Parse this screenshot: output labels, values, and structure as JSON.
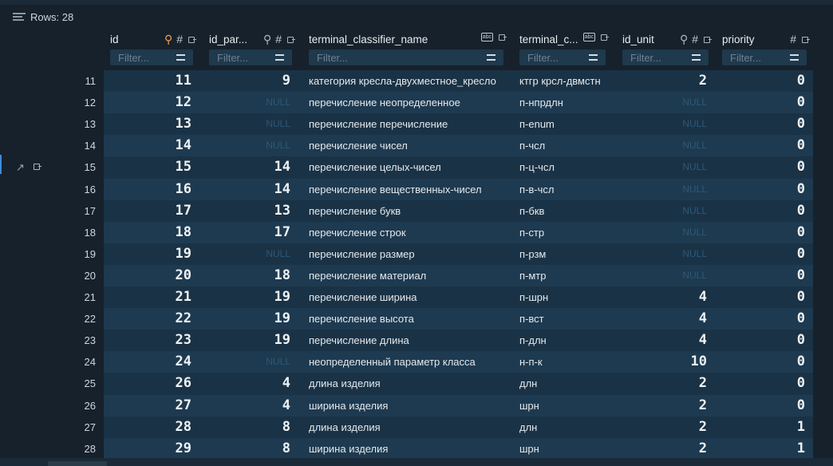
{
  "rows_label": "Rows: 28",
  "columns": [
    {
      "key": "id",
      "label": "id",
      "filter": "Filter...",
      "icons": [
        "key-icon",
        "hash-icon",
        "pin-icon"
      ]
    },
    {
      "key": "id_parent",
      "label": "id_par...",
      "filter": "Filter...",
      "icons": [
        "key-icon",
        "hash-icon",
        "pin-icon"
      ]
    },
    {
      "key": "name",
      "label": "terminal_classifier_name",
      "filter": "Filter...",
      "icons": [
        "abc-icon",
        "pin-icon"
      ]
    },
    {
      "key": "abbr",
      "label": "terminal_c...",
      "filter": "Filter...",
      "icons": [
        "abc-icon",
        "pin-icon"
      ]
    },
    {
      "key": "id_unit",
      "label": "id_unit",
      "filter": "Filter...",
      "icons": [
        "key-icon",
        "hash-icon",
        "pin-icon"
      ]
    },
    {
      "key": "priority",
      "label": "priority",
      "filter": "Filter...",
      "icons": [
        "hash-icon",
        "pin-icon"
      ]
    }
  ],
  "null_text": "NULL",
  "rows": [
    {
      "n": "11",
      "id": "11",
      "id_parent": "9",
      "name": "категория кресла-двухместное_кресло",
      "abbr": "ктгр крсл-двмстн",
      "id_unit": "2",
      "priority": "0"
    },
    {
      "n": "12",
      "id": "12",
      "id_parent": null,
      "name": "перечисление неопределенное",
      "abbr": "п-нпрдлн",
      "id_unit": null,
      "priority": "0"
    },
    {
      "n": "13",
      "id": "13",
      "id_parent": null,
      "name": "перечисление перечисление",
      "abbr": "п-enum",
      "id_unit": null,
      "priority": "0"
    },
    {
      "n": "14",
      "id": "14",
      "id_parent": null,
      "name": "перечисление чисел",
      "abbr": "п-чсл",
      "id_unit": null,
      "priority": "0"
    },
    {
      "n": "15",
      "id": "15",
      "id_parent": "14",
      "name": "перечисление целых-чисел",
      "abbr": "п-ц-чсл",
      "id_unit": null,
      "priority": "0"
    },
    {
      "n": "16",
      "id": "16",
      "id_parent": "14",
      "name": "перечисление вещественных-чисел",
      "abbr": "п-в-чсл",
      "id_unit": null,
      "priority": "0"
    },
    {
      "n": "17",
      "id": "17",
      "id_parent": "13",
      "name": "перечисление букв",
      "abbr": "п-бкв",
      "id_unit": null,
      "priority": "0"
    },
    {
      "n": "18",
      "id": "18",
      "id_parent": "17",
      "name": "перечисление строк",
      "abbr": "п-стр",
      "id_unit": null,
      "priority": "0"
    },
    {
      "n": "19",
      "id": "19",
      "id_parent": null,
      "name": "перечисление размер",
      "abbr": "п-рзм",
      "id_unit": null,
      "priority": "0"
    },
    {
      "n": "20",
      "id": "20",
      "id_parent": "18",
      "name": "перечисление материал",
      "abbr": "п-мтр",
      "id_unit": null,
      "priority": "0"
    },
    {
      "n": "21",
      "id": "21",
      "id_parent": "19",
      "name": "перечисление ширина",
      "abbr": "п-шрн",
      "id_unit": "4",
      "priority": "0"
    },
    {
      "n": "22",
      "id": "22",
      "id_parent": "19",
      "name": "перечисление высота",
      "abbr": "п-вст",
      "id_unit": "4",
      "priority": "0"
    },
    {
      "n": "23",
      "id": "23",
      "id_parent": "19",
      "name": "перечисление длина",
      "abbr": "п-длн",
      "id_unit": "4",
      "priority": "0"
    },
    {
      "n": "24",
      "id": "24",
      "id_parent": null,
      "name": "неопределенный параметр класса",
      "abbr": "н-п-к",
      "id_unit": "10",
      "priority": "0"
    },
    {
      "n": "25",
      "id": "26",
      "id_parent": "4",
      "name": "длина изделия",
      "abbr": "длн",
      "id_unit": "2",
      "priority": "0"
    },
    {
      "n": "26",
      "id": "27",
      "id_parent": "4",
      "name": "ширина изделия",
      "abbr": "шрн",
      "id_unit": "2",
      "priority": "0"
    },
    {
      "n": "27",
      "id": "28",
      "id_parent": "8",
      "name": "длина изделия",
      "abbr": "длн",
      "id_unit": "2",
      "priority": "1"
    },
    {
      "n": "28",
      "id": "29",
      "id_parent": "8",
      "name": "ширина изделия",
      "abbr": "шрн",
      "id_unit": "2",
      "priority": "1"
    }
  ]
}
